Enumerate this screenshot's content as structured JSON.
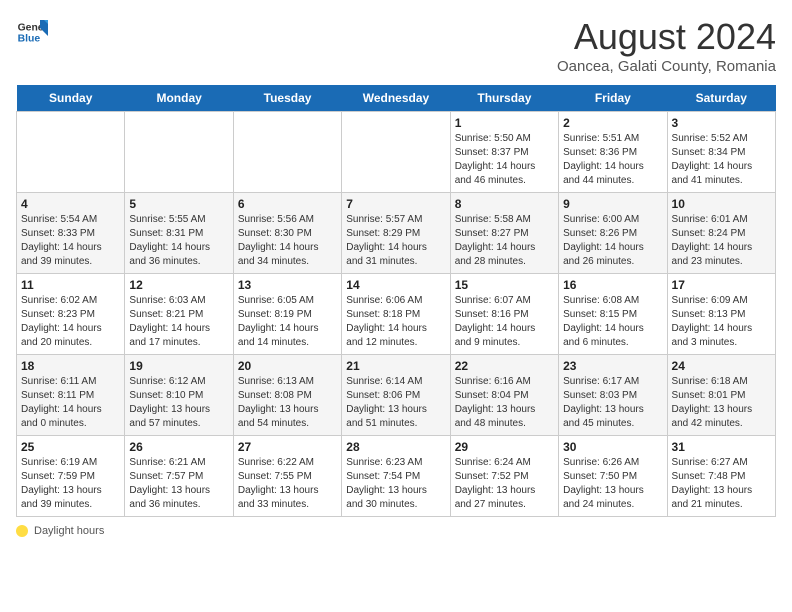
{
  "header": {
    "logo_general": "General",
    "logo_blue": "Blue",
    "main_title": "August 2024",
    "subtitle": "Oancea, Galati County, Romania"
  },
  "calendar": {
    "days_of_week": [
      "Sunday",
      "Monday",
      "Tuesday",
      "Wednesday",
      "Thursday",
      "Friday",
      "Saturday"
    ],
    "weeks": [
      [
        {
          "day": "",
          "info": ""
        },
        {
          "day": "",
          "info": ""
        },
        {
          "day": "",
          "info": ""
        },
        {
          "day": "",
          "info": ""
        },
        {
          "day": "1",
          "info": "Sunrise: 5:50 AM\nSunset: 8:37 PM\nDaylight: 14 hours and 46 minutes."
        },
        {
          "day": "2",
          "info": "Sunrise: 5:51 AM\nSunset: 8:36 PM\nDaylight: 14 hours and 44 minutes."
        },
        {
          "day": "3",
          "info": "Sunrise: 5:52 AM\nSunset: 8:34 PM\nDaylight: 14 hours and 41 minutes."
        }
      ],
      [
        {
          "day": "4",
          "info": "Sunrise: 5:54 AM\nSunset: 8:33 PM\nDaylight: 14 hours and 39 minutes."
        },
        {
          "day": "5",
          "info": "Sunrise: 5:55 AM\nSunset: 8:31 PM\nDaylight: 14 hours and 36 minutes."
        },
        {
          "day": "6",
          "info": "Sunrise: 5:56 AM\nSunset: 8:30 PM\nDaylight: 14 hours and 34 minutes."
        },
        {
          "day": "7",
          "info": "Sunrise: 5:57 AM\nSunset: 8:29 PM\nDaylight: 14 hours and 31 minutes."
        },
        {
          "day": "8",
          "info": "Sunrise: 5:58 AM\nSunset: 8:27 PM\nDaylight: 14 hours and 28 minutes."
        },
        {
          "day": "9",
          "info": "Sunrise: 6:00 AM\nSunset: 8:26 PM\nDaylight: 14 hours and 26 minutes."
        },
        {
          "day": "10",
          "info": "Sunrise: 6:01 AM\nSunset: 8:24 PM\nDaylight: 14 hours and 23 minutes."
        }
      ],
      [
        {
          "day": "11",
          "info": "Sunrise: 6:02 AM\nSunset: 8:23 PM\nDaylight: 14 hours and 20 minutes."
        },
        {
          "day": "12",
          "info": "Sunrise: 6:03 AM\nSunset: 8:21 PM\nDaylight: 14 hours and 17 minutes."
        },
        {
          "day": "13",
          "info": "Sunrise: 6:05 AM\nSunset: 8:19 PM\nDaylight: 14 hours and 14 minutes."
        },
        {
          "day": "14",
          "info": "Sunrise: 6:06 AM\nSunset: 8:18 PM\nDaylight: 14 hours and 12 minutes."
        },
        {
          "day": "15",
          "info": "Sunrise: 6:07 AM\nSunset: 8:16 PM\nDaylight: 14 hours and 9 minutes."
        },
        {
          "day": "16",
          "info": "Sunrise: 6:08 AM\nSunset: 8:15 PM\nDaylight: 14 hours and 6 minutes."
        },
        {
          "day": "17",
          "info": "Sunrise: 6:09 AM\nSunset: 8:13 PM\nDaylight: 14 hours and 3 minutes."
        }
      ],
      [
        {
          "day": "18",
          "info": "Sunrise: 6:11 AM\nSunset: 8:11 PM\nDaylight: 14 hours and 0 minutes."
        },
        {
          "day": "19",
          "info": "Sunrise: 6:12 AM\nSunset: 8:10 PM\nDaylight: 13 hours and 57 minutes."
        },
        {
          "day": "20",
          "info": "Sunrise: 6:13 AM\nSunset: 8:08 PM\nDaylight: 13 hours and 54 minutes."
        },
        {
          "day": "21",
          "info": "Sunrise: 6:14 AM\nSunset: 8:06 PM\nDaylight: 13 hours and 51 minutes."
        },
        {
          "day": "22",
          "info": "Sunrise: 6:16 AM\nSunset: 8:04 PM\nDaylight: 13 hours and 48 minutes."
        },
        {
          "day": "23",
          "info": "Sunrise: 6:17 AM\nSunset: 8:03 PM\nDaylight: 13 hours and 45 minutes."
        },
        {
          "day": "24",
          "info": "Sunrise: 6:18 AM\nSunset: 8:01 PM\nDaylight: 13 hours and 42 minutes."
        }
      ],
      [
        {
          "day": "25",
          "info": "Sunrise: 6:19 AM\nSunset: 7:59 PM\nDaylight: 13 hours and 39 minutes."
        },
        {
          "day": "26",
          "info": "Sunrise: 6:21 AM\nSunset: 7:57 PM\nDaylight: 13 hours and 36 minutes."
        },
        {
          "day": "27",
          "info": "Sunrise: 6:22 AM\nSunset: 7:55 PM\nDaylight: 13 hours and 33 minutes."
        },
        {
          "day": "28",
          "info": "Sunrise: 6:23 AM\nSunset: 7:54 PM\nDaylight: 13 hours and 30 minutes."
        },
        {
          "day": "29",
          "info": "Sunrise: 6:24 AM\nSunset: 7:52 PM\nDaylight: 13 hours and 27 minutes."
        },
        {
          "day": "30",
          "info": "Sunrise: 6:26 AM\nSunset: 7:50 PM\nDaylight: 13 hours and 24 minutes."
        },
        {
          "day": "31",
          "info": "Sunrise: 6:27 AM\nSunset: 7:48 PM\nDaylight: 13 hours and 21 minutes."
        }
      ]
    ]
  },
  "footer": {
    "label": "Daylight hours"
  }
}
